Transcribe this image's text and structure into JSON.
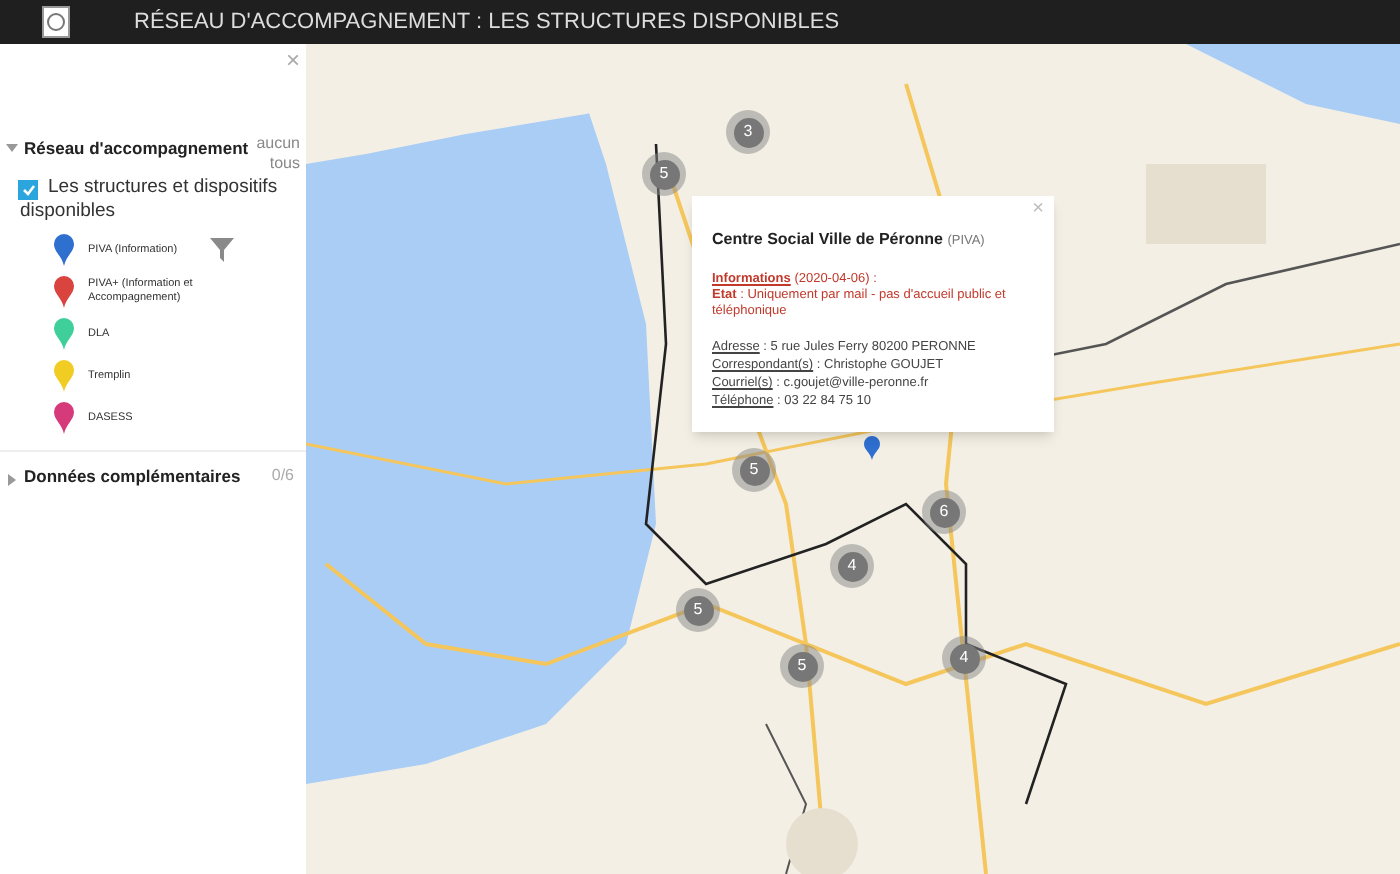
{
  "header": {
    "title": "RÉSEAU D'ACCOMPAGNEMENT : LES STRUCTURES DISPONIBLES"
  },
  "sidebar": {
    "close": "×",
    "sections": [
      {
        "title": "Réseau d'accompagnement",
        "expanded": true,
        "links": [
          "aucun",
          "tous"
        ],
        "layer": {
          "label": "Les structures et dispositifs disponibles",
          "checked": true
        },
        "legend": [
          {
            "label": "PIVA (Information)",
            "color": "#2f6fd0"
          },
          {
            "label": "PIVA+ (Information et Accompagnement)",
            "color": "#d9443f"
          },
          {
            "label": "DLA",
            "color": "#3fcf9b"
          },
          {
            "label": "Tremplin",
            "color": "#f1cc22"
          },
          {
            "label": "DASESS",
            "color": "#d63a7a"
          }
        ]
      },
      {
        "title": "Données complémentaires",
        "expanded": false,
        "count": "0/6"
      }
    ]
  },
  "map": {
    "clusters": [
      {
        "count": "3"
      },
      {
        "count": "5"
      },
      {
        "count": "5"
      },
      {
        "count": "6"
      },
      {
        "count": "4"
      },
      {
        "count": "5"
      },
      {
        "count": "4"
      },
      {
        "count": "5"
      }
    ],
    "popup": {
      "close": "×",
      "title": "Centre Social Ville de Péronne",
      "type": "(PIVA)",
      "info_label": "Informations",
      "info_date": "(2020-04-06) :",
      "state": "**Etat** : Uniquement par mail - pas d'accueil public et téléphonique",
      "fields": [
        {
          "label": "Adresse",
          "value": ": 5 rue Jules Ferry 80200 PERONNE"
        },
        {
          "label": "Correspondant(s)",
          "value": ": Christophe GOUJET"
        },
        {
          "label": "Courriel(s)",
          "value": ": c.goujet@ville-peronne.fr"
        },
        {
          "label": "Téléphone",
          "value": ": 03 22 84 75 10"
        }
      ]
    }
  }
}
